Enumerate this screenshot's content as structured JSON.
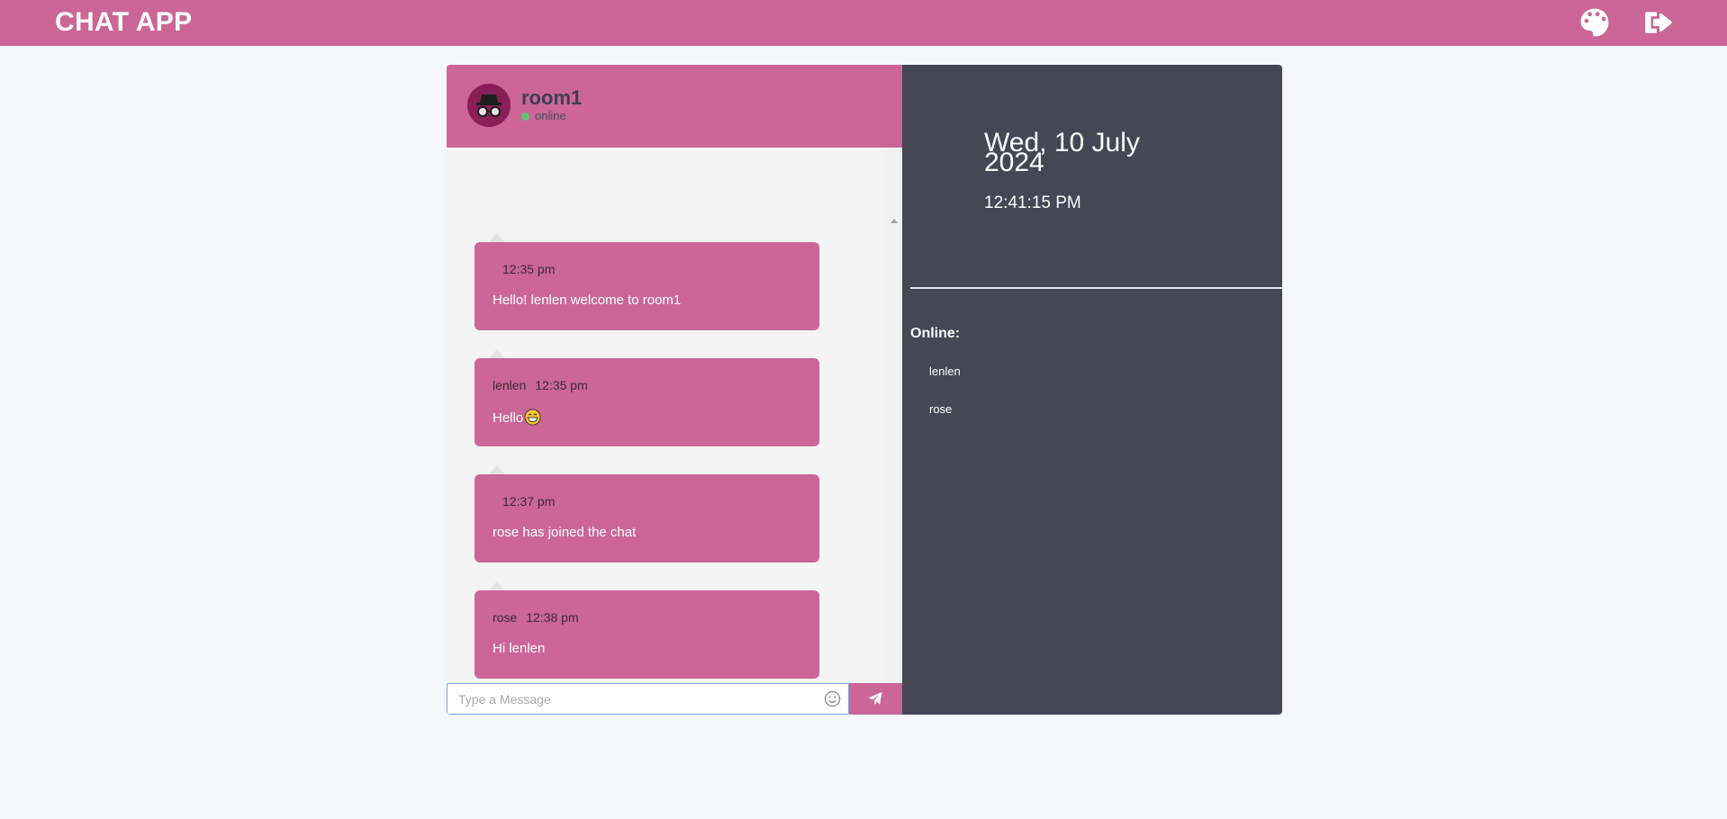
{
  "app": {
    "title": "CHAT APP"
  },
  "header_icons": {
    "theme": "palette-icon",
    "logout": "sign-out-icon"
  },
  "room": {
    "name": "room1",
    "status": "online",
    "avatar": "incognito-avatar"
  },
  "messages": [
    {
      "sender": "",
      "time": "12:35 pm",
      "text": "Hello! lenlen welcome to room1"
    },
    {
      "sender": "lenlen",
      "time": "12:35 pm",
      "text": "Hello",
      "emoji": "grinning-face-emoji"
    },
    {
      "sender": "",
      "time": "12:37 pm",
      "text": "rose has joined the chat"
    },
    {
      "sender": "rose",
      "time": "12:38 pm",
      "text": "Hi lenlen"
    }
  ],
  "composer": {
    "placeholder": "Type a Message",
    "value": ""
  },
  "info": {
    "date": "Wed, 10 July 2024",
    "time": "12:41:15 PM",
    "online_title": "Online:",
    "online_users": [
      "lenlen",
      "rose"
    ]
  },
  "colors": {
    "primary": "#cb6697",
    "sidebar": "#454755",
    "background": "#f6f7fc",
    "avatar": "#8a1f57",
    "online_dot": "#61c27a"
  }
}
